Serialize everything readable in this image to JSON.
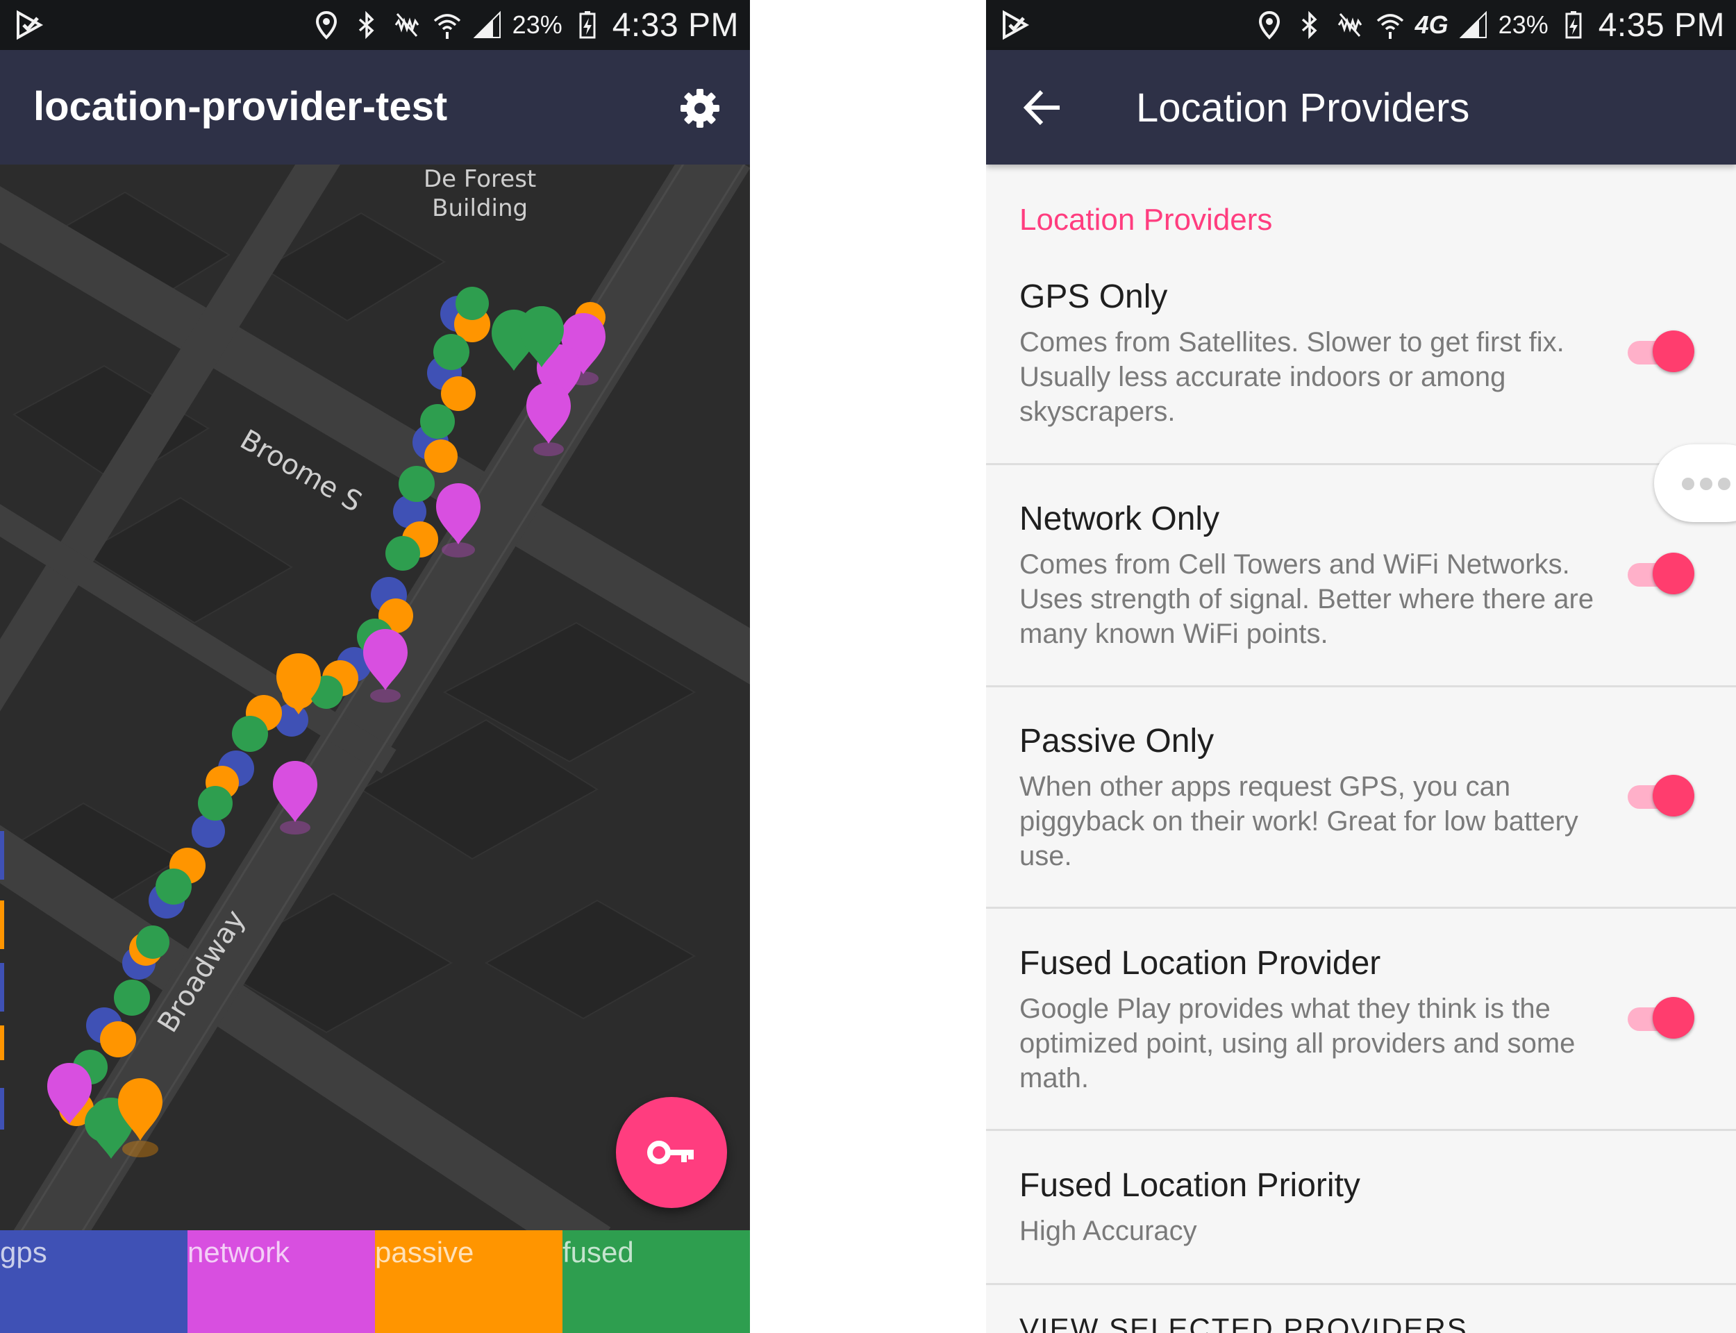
{
  "left_screen": {
    "status_bar": {
      "battery": "23%",
      "time": "4:33 PM"
    },
    "app_bar": {
      "title": "location-provider-test"
    },
    "map": {
      "labels": {
        "building_line1": "De Forest",
        "building_line2": "Building",
        "street_broome": "Broome S",
        "street_broadway": "Broadway"
      }
    },
    "legend": [
      {
        "label": "gps",
        "color": "#3f51b5"
      },
      {
        "label": "network",
        "color": "#d84fe0"
      },
      {
        "label": "passive",
        "color": "#ff9500"
      },
      {
        "label": "fused",
        "color": "#2e9e4f"
      }
    ],
    "fab": {
      "icon": "key-icon"
    }
  },
  "right_screen": {
    "status_bar": {
      "network_type": "4G",
      "battery": "23%",
      "time": "4:35 PM"
    },
    "app_bar": {
      "title": "Location Providers"
    },
    "section_header": "Location Providers",
    "preferences": [
      {
        "title": "GPS Only",
        "summary": "Comes from Satellites. Slower to get first fix. Usually less accurate indoors or among skyscrapers.",
        "enabled": true
      },
      {
        "title": "Network Only",
        "summary": "Comes from Cell Towers and WiFi Networks. Uses strength of signal. Better where there are many known WiFi points.",
        "enabled": true
      },
      {
        "title": "Passive Only",
        "summary": "When other apps request GPS, you can piggyback on their work! Great for low battery use.",
        "enabled": true
      },
      {
        "title": "Fused Location Provider",
        "summary": "Google Play provides what they think is the optimized point, using all providers and some math.",
        "enabled": true
      },
      {
        "title": "Fused Location Priority",
        "summary": "High Accuracy"
      }
    ],
    "cut_off_item": "VIEW SELECTED PROVIDERS"
  }
}
